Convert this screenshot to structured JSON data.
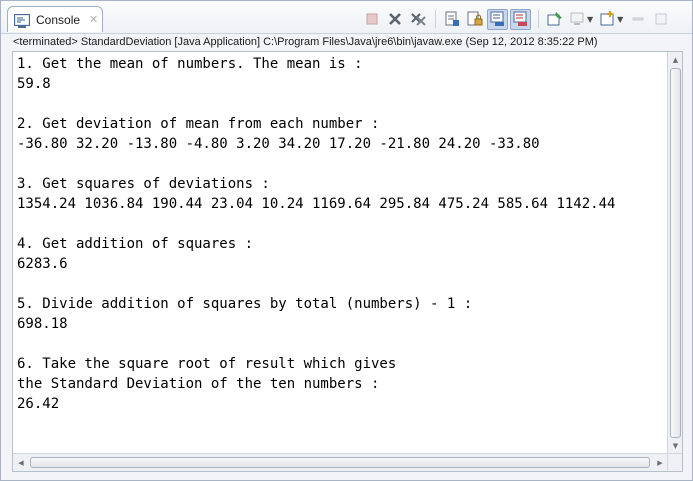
{
  "tab": {
    "label": "Console",
    "icon": "console-icon",
    "close_icon": "close-icon"
  },
  "toolbar": {
    "buttons": [
      {
        "icon": "terminate-icon",
        "state": "disabled"
      },
      {
        "icon": "remove-launch-icon",
        "state": "normal"
      },
      {
        "icon": "remove-all-terminated-icon",
        "state": "normal"
      },
      {
        "icon": "clear-console-icon",
        "state": "normal"
      },
      {
        "icon": "scroll-lock-icon",
        "state": "normal"
      },
      {
        "icon": "show-on-stdout-icon",
        "state": "pressed"
      },
      {
        "icon": "show-on-stderr-icon",
        "state": "pressed"
      },
      {
        "icon": "pin-console-icon",
        "state": "normal"
      },
      {
        "icon": "display-selected-console-icon",
        "state": "disabled"
      },
      {
        "icon": "open-console-icon",
        "state": "normal"
      },
      {
        "icon": "minimize-icon",
        "state": "normal"
      },
      {
        "icon": "maximize-icon",
        "state": "normal"
      }
    ]
  },
  "status": "<terminated> StandardDeviation [Java Application] C:\\Program Files\\Java\\jre6\\bin\\javaw.exe (Sep 12, 2012 8:35:22 PM)",
  "console": {
    "lines": [
      "1. Get the mean of numbers. The mean is :",
      "59.8",
      "",
      "2. Get deviation of mean from each number :",
      "-36.80 32.20 -13.80 -4.80 3.20 34.20 17.20 -21.80 24.20 -33.80",
      "",
      "3. Get squares of deviations :",
      "1354.24 1036.84 190.44 23.04 10.24 1169.64 295.84 475.24 585.64 1142.44",
      "",
      "4. Get addition of squares :",
      "6283.6",
      "",
      "5. Divide addition of squares by total (numbers) - 1 :",
      "698.18",
      "",
      "6. Take the square root of result which gives",
      "the Standard Deviation of the ten numbers :",
      "26.42"
    ]
  },
  "colors": {
    "accent": "#c8d7ee",
    "border": "#a8b3c4",
    "text": "#000000"
  }
}
